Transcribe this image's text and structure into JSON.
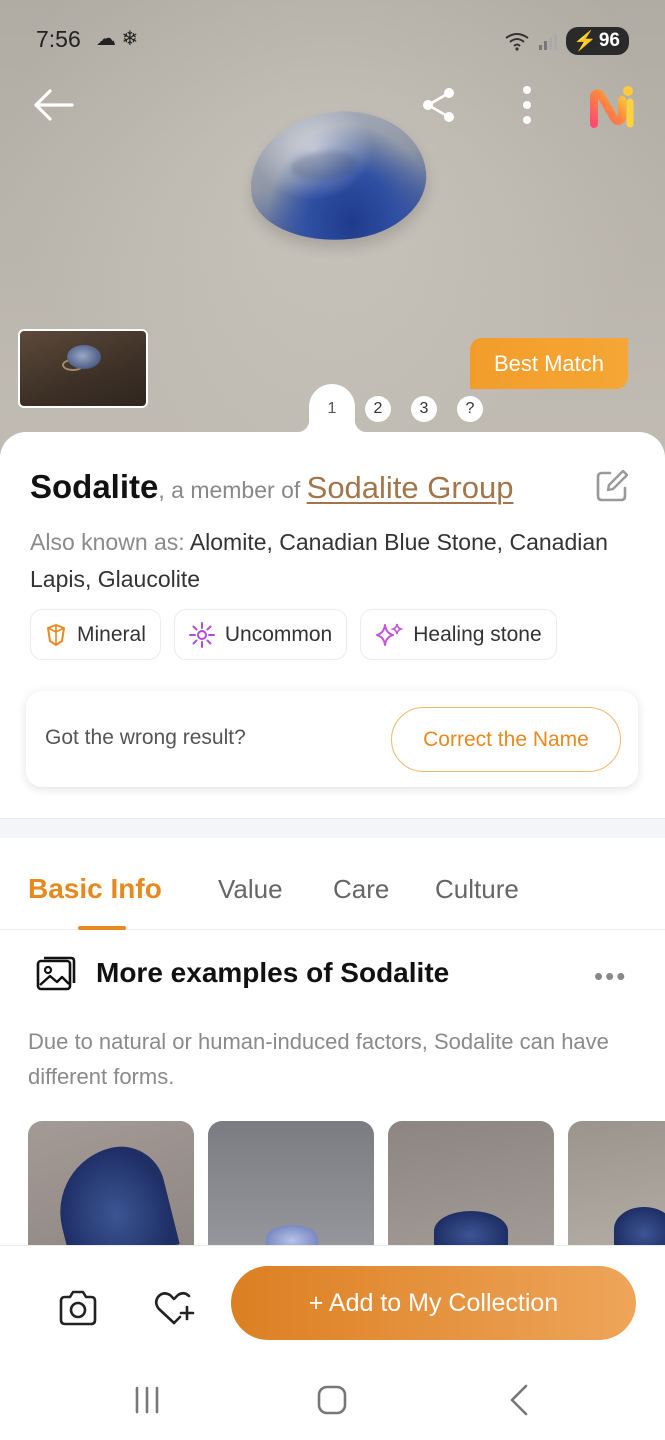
{
  "status_bar": {
    "time": "7:56",
    "left_icons": "☁ ❄",
    "signal_icons": "wifi-signal",
    "battery": "96"
  },
  "toolbar": {
    "back_icon": "arrow-left-icon",
    "share_icon": "share-icon",
    "more_icon": "more-vertical-icon",
    "brand_icon": "app-logo-icon"
  },
  "hero": {
    "best_match_label": "Best Match",
    "pages": [
      "1",
      "2",
      "3",
      "?"
    ],
    "active_page": "1"
  },
  "result": {
    "name": "Sodalite",
    "member_prefix": ", a member of ",
    "group_name": "Sodalite Group",
    "aka_label": "Also known as: ",
    "aka_value": "Alomite, Canadian Blue Stone, Canadian Lapis, Glaucolite",
    "chips": [
      {
        "label": "Mineral",
        "icon": "crystal-icon",
        "color": "#e8891f"
      },
      {
        "label": "Uncommon",
        "icon": "sparkle-sun-icon",
        "color": "#b04fd6"
      },
      {
        "label": "Healing stone",
        "icon": "sparkles-icon",
        "color": "#c454d8"
      }
    ]
  },
  "wrong_result": {
    "text": "Got the wrong result?",
    "button": "Correct the Name"
  },
  "section_tabs": [
    "Basic Info",
    "Value",
    "Care",
    "Culture"
  ],
  "active_tab": "Basic Info",
  "examples": {
    "title": "More examples of Sodalite",
    "more": "•••",
    "description": "Due to natural or human-induced factors, Sodalite can have different forms."
  },
  "bottom_bar": {
    "add_button": "+ Add to My Collection",
    "camera_icon": "camera-icon",
    "favorite_icon": "heart-plus-icon"
  },
  "nav_bar": {
    "recents_icon": "recents-icon",
    "home_icon": "home-icon",
    "back_icon": "nav-back-icon"
  },
  "colors": {
    "accent": "#e8891f",
    "link": "#a1764a",
    "best_match": "#f29d2b"
  }
}
